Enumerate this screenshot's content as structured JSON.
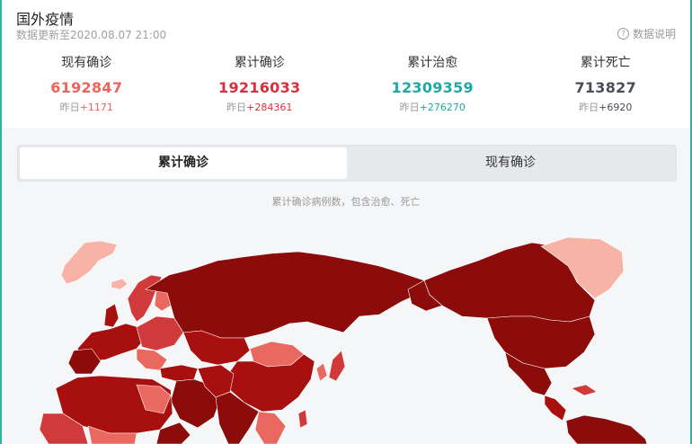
{
  "header": {
    "title": "国外疫情",
    "updated": "数据更新至2020.08.07 21:00",
    "help_label": "数据说明",
    "help_icon": "question-icon"
  },
  "stats": [
    {
      "label": "现有确诊",
      "value": "6192847",
      "delta_prefix": "昨日",
      "delta": "+1171",
      "color": "#f0625a"
    },
    {
      "label": "累计确诊",
      "value": "19216033",
      "delta_prefix": "昨日",
      "delta": "+284361",
      "color": "#d6303e"
    },
    {
      "label": "累计治愈",
      "value": "12309359",
      "delta_prefix": "昨日",
      "delta": "+276270",
      "color": "#1fa9a3"
    },
    {
      "label": "累计死亡",
      "value": "713827",
      "delta_prefix": "昨日",
      "delta": "+6920",
      "color": "#4a4e59"
    }
  ],
  "tabs": [
    {
      "label": "累计确诊",
      "active": true
    },
    {
      "label": "现有确诊",
      "active": false
    }
  ],
  "map": {
    "caption": "累计确诊病例数，包含治愈、死亡",
    "colors": {
      "darkest": "#8b0c0b",
      "dark": "#a80f0f",
      "mid": "#d13a3a",
      "light": "#e9685f",
      "pale": "#f6b3a6",
      "ocean": "#f5f6f8"
    }
  }
}
